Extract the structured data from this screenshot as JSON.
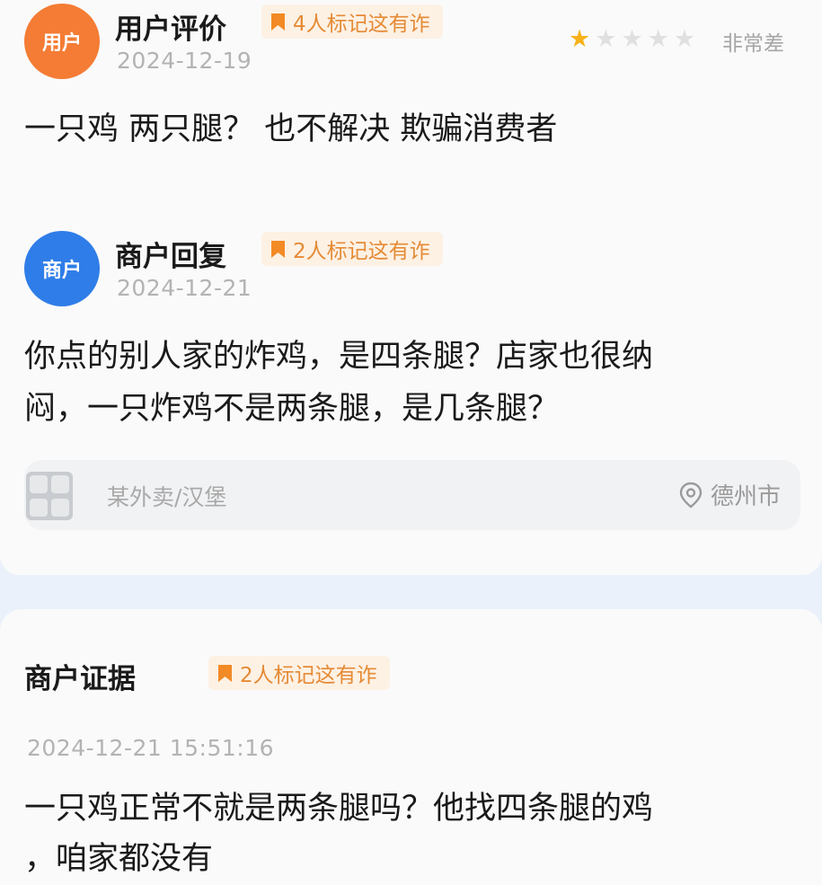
{
  "review": {
    "avatar_label": "用户",
    "title": "用户评价",
    "tag": "4人标记这有诈",
    "date": "2024-12-19",
    "rating": 1,
    "rating_max": 5,
    "rating_text": "非常差",
    "content": "一只鸡 两只腿？ 也不解决 欺骗消费者"
  },
  "reply": {
    "avatar_label": "商户",
    "title": "商户回复",
    "tag": "2人标记这有诈",
    "date": "2024-12-21",
    "content_line1": "你点的别人家的炸鸡，是四条腿？店家也很纳",
    "content_line2": "闷，一只炸鸡不是两条腿，是几条腿？"
  },
  "shop": {
    "name": "某外卖/汉堡",
    "location": "德州市"
  },
  "evidence": {
    "title": "商户证据",
    "tag": "2人标记这有诈",
    "datetime": "2024-12-21 15:51:16",
    "content_line1": "一只鸡正常不就是两条腿吗？他找四条腿的鸡",
    "content_line2": "，咱家都没有"
  },
  "colors": {
    "user_avatar": "#f47c34",
    "merchant_avatar": "#2f7de8",
    "tag_text": "#e58a35",
    "tag_bg": "#fdf1e4",
    "star_on": "#f7b21b"
  }
}
